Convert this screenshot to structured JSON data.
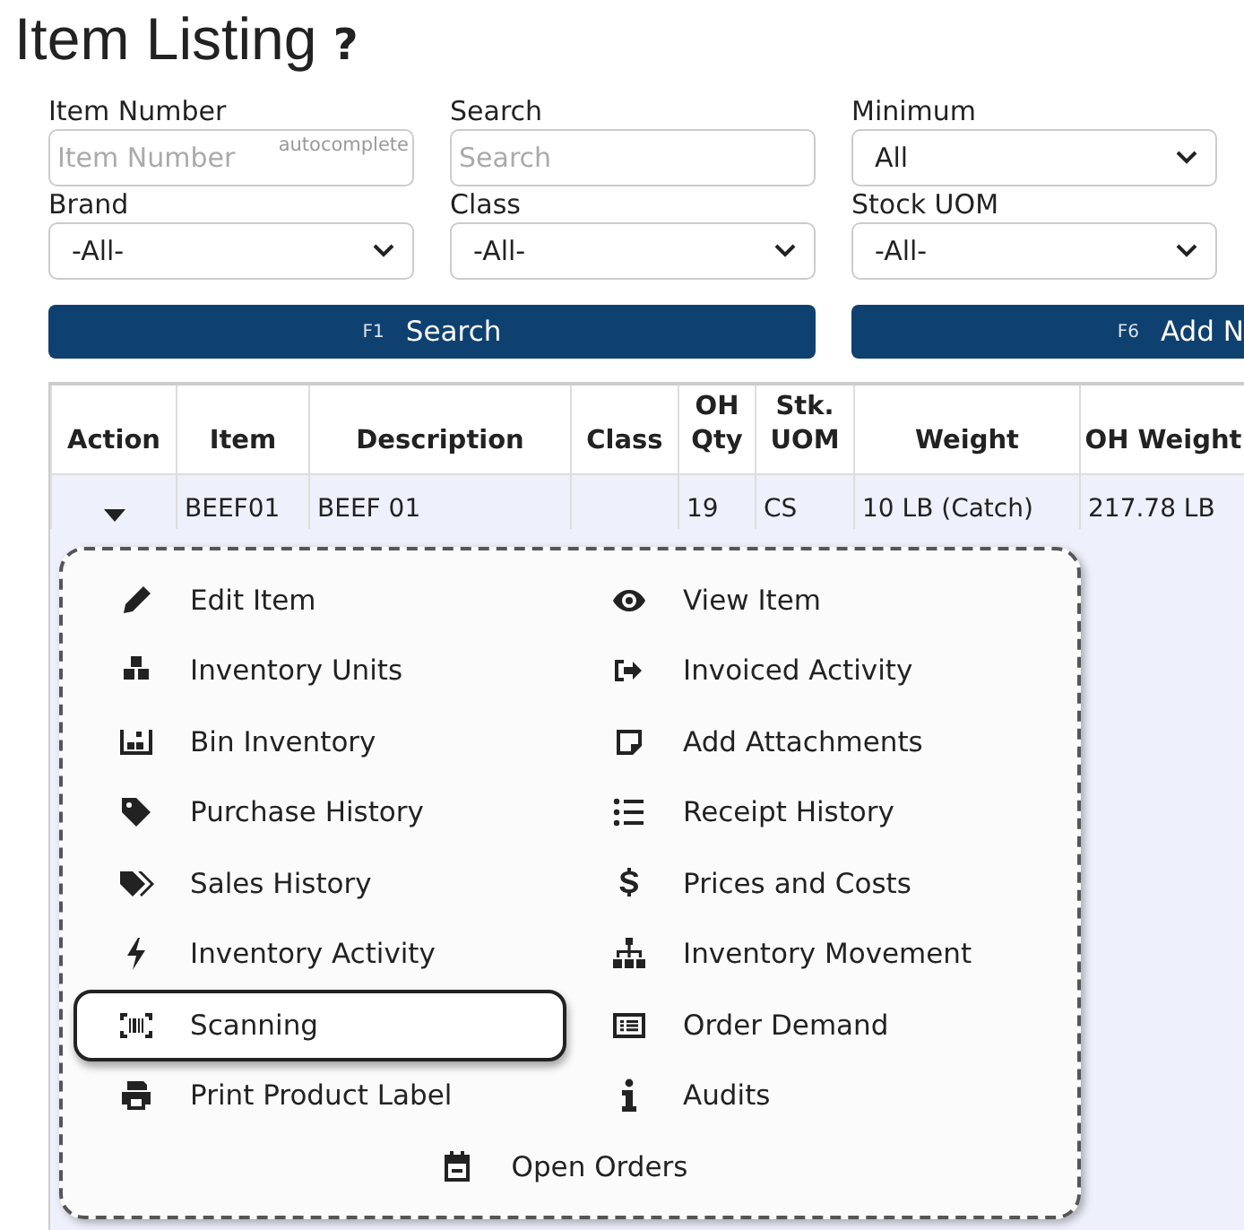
{
  "page": {
    "title": "Item Listing",
    "help_mark": "?"
  },
  "filters": [
    {
      "label": "Item Number",
      "kind": "text",
      "placeholder": "Item Number",
      "hint": "autocomplete"
    },
    {
      "label": "Search",
      "kind": "text",
      "placeholder": "Search"
    },
    {
      "label": "Minimum",
      "kind": "select",
      "value": "All"
    },
    {
      "label": "Brand",
      "kind": "select",
      "value": "-All-"
    },
    {
      "label": "Class",
      "kind": "select",
      "value": "-All-"
    },
    {
      "label": "Stock UOM",
      "kind": "select",
      "value": "-All-"
    }
  ],
  "buttons": [
    {
      "key": "F1",
      "label": "Search"
    },
    {
      "key": "F6",
      "label": "Add N"
    }
  ],
  "table": {
    "columns": [
      "Action",
      "Item",
      "Description",
      "Class",
      "OH Qty",
      "Stk. UOM",
      "Weight",
      "OH Weight"
    ],
    "rows": [
      {
        "cells": [
          "",
          "BEEF01",
          "BEEF 01",
          "",
          "19",
          "CS",
          "10 LB (Catch)",
          "217.78 LB"
        ]
      }
    ]
  },
  "action_menu": {
    "left_column": [
      {
        "label": "Edit Item",
        "selected": false
      },
      {
        "label": "Inventory Units",
        "selected": false
      },
      {
        "label": "Bin Inventory",
        "selected": false
      },
      {
        "label": "Purchase History",
        "selected": false
      },
      {
        "label": "Sales History",
        "selected": false
      },
      {
        "label": "Inventory Activity",
        "selected": false
      },
      {
        "label": "Scanning",
        "selected": true
      },
      {
        "label": "Print Product Label",
        "selected": false
      }
    ],
    "right_column": [
      {
        "label": "View Item",
        "selected": false
      },
      {
        "label": "Invoiced Activity",
        "selected": false
      },
      {
        "label": "Add Attachments",
        "selected": false
      },
      {
        "label": "Receipt History",
        "selected": false
      },
      {
        "label": "Prices and Costs",
        "selected": false
      },
      {
        "label": "Inventory Movement",
        "selected": false
      },
      {
        "label": "Order Demand",
        "selected": false
      },
      {
        "label": "Audits",
        "selected": false
      }
    ],
    "footer_item": {
      "label": "Open Orders",
      "selected": false
    }
  }
}
